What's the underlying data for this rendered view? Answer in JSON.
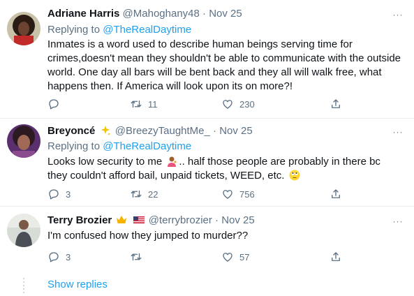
{
  "tweets": [
    {
      "name": "Adriane Harris",
      "handle": "@Mahoghany48",
      "dot": "·",
      "date": "Nov 25",
      "replying_prefix": "Replying to ",
      "replying_to": "@TheRealDaytime",
      "text": "Inmates is a word used to describe human beings serving time for crimes,doesn't mean they shouldn't be able to communicate with the outside world. One day all bars will be bent back and they all will walk free, what happens then. If America will look upon its on more?!",
      "replies": "",
      "retweets": "11",
      "likes": "230"
    },
    {
      "name": "Breyoncé",
      "handle": "@BreezyTaughtMe_",
      "dot": "·",
      "date": "Nov 25",
      "replying_prefix": "Replying to ",
      "replying_to": "@TheRealDaytime",
      "text_part1": "Looks low security to me",
      "text_part2": ".. half those people are probably in there bc they couldn't afford bail, unpaid tickets, WEED, etc.",
      "replies": "3",
      "retweets": "22",
      "likes": "756"
    },
    {
      "name": "Terry Brozier",
      "handle": "@terrybrozier",
      "dot": "·",
      "date": "Nov 25",
      "text": "I'm confused how they jumped to murder??",
      "replies": "3",
      "retweets": "",
      "likes": "57"
    }
  ],
  "more_label": "···",
  "show_replies": "Show replies",
  "colors": {
    "link": "#1da1f2",
    "muted": "#5b7083",
    "border": "#e6ecf0"
  },
  "icons": [
    "reply-icon",
    "retweet-icon",
    "like-icon",
    "share-icon",
    "more-icon",
    "sparkles-icon",
    "crown-icon",
    "us-flag-icon",
    "person-tipping-hand-icon",
    "rolling-eyes-icon"
  ]
}
